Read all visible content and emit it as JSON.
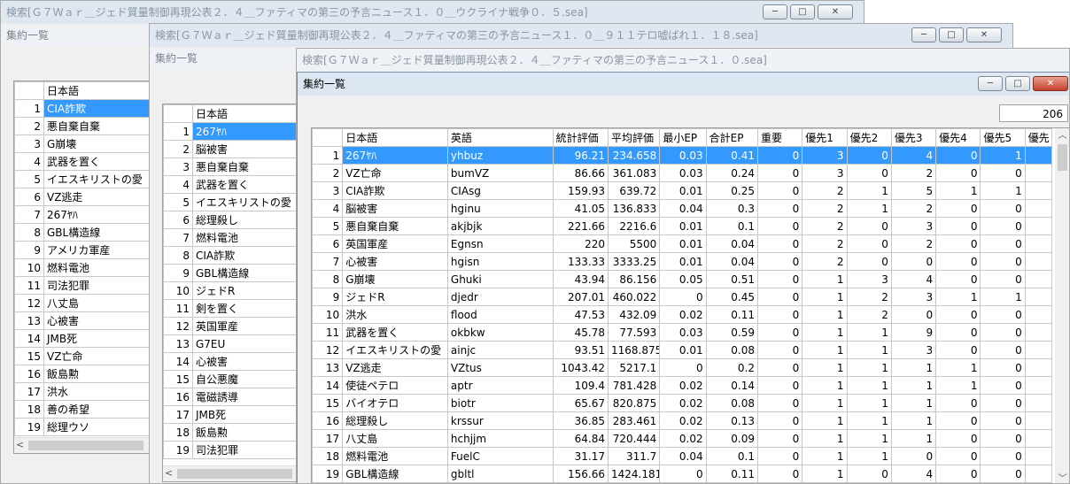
{
  "windows": [
    {
      "title": "検索[Ｇ７Ｗａｒ＿ジェド質量制御再現公表２．４＿ファティマの第三の予言ニュース１．０＿ウクライナ戦争０．５.sea]",
      "sub": "集約一覧",
      "header": "日本語",
      "rownums": [
        "1",
        "2",
        "3",
        "4",
        "5",
        "6",
        "7",
        "8",
        "9",
        "10",
        "11",
        "12",
        "13",
        "14",
        "15",
        "16",
        "17",
        "18",
        "19"
      ],
      "rows": [
        "CIA詐欺",
        "悪自棄自棄",
        "G崩壊",
        "武器を置く",
        "イエスキリストの愛",
        "VZ逃走",
        "267ﾔﾊ",
        "GBL構造線",
        "アメリカ軍産",
        "燃料電池",
        "司法犯罪",
        "八丈島",
        "心被害",
        "JMB死",
        "VZ亡命",
        "飯島勲",
        "洪水",
        "善の希望",
        "総理ウソ"
      ]
    },
    {
      "title": "検索[Ｇ７Ｗａｒ＿ジェド質量制御再現公表２．４＿ファティマの第三の予言ニュース１．０＿９１１テロ嘘ばれ１．１８.sea]",
      "sub": "集約一覧",
      "header": "日本語",
      "rownums": [
        "1",
        "2",
        "3",
        "4",
        "5",
        "6",
        "7",
        "8",
        "9",
        "10",
        "11",
        "12",
        "13",
        "14",
        "15",
        "16",
        "17",
        "18",
        "19"
      ],
      "rows": [
        "267ﾔﾊ",
        "脳被害",
        "悪自棄自棄",
        "武器を置く",
        "イエスキリストの愛",
        "総理殺し",
        "燃料電池",
        "CIA詐欺",
        "GBL構造線",
        "ジェドR",
        "剣を置く",
        "英国軍産",
        "G7EU",
        "心被害",
        "自公悪魔",
        "電磁誘導",
        "JMB死",
        "飯島勲",
        "司法犯罪"
      ]
    },
    {
      "title": "検索[Ｇ７Ｗａｒ＿ジェド質量制御再現公表２．４＿ファティマの第三の予言ニュース１．０.sea]",
      "sub": "集約一覧"
    }
  ],
  "active": {
    "title": "集約一覧",
    "count": "206",
    "columns": [
      "日本語",
      "英語",
      "統計評価",
      "平均評価",
      "最小EP",
      "合計EP",
      "重要",
      "優先1",
      "優先2",
      "優先3",
      "優先4",
      "優先5",
      "優先"
    ],
    "rows": [
      [
        "1",
        "267ﾔﾊ",
        "yhbuz",
        "96.21",
        "234.658",
        "0.03",
        "0.41",
        "0",
        "3",
        "0",
        "4",
        "0",
        "1"
      ],
      [
        "2",
        "VZ亡命",
        "bumVZ",
        "86.66",
        "361.083",
        "0.03",
        "0.24",
        "0",
        "3",
        "0",
        "2",
        "0",
        "0"
      ],
      [
        "3",
        "CIA詐欺",
        "CIAsg",
        "159.93",
        "639.72",
        "0.01",
        "0.25",
        "0",
        "2",
        "1",
        "5",
        "1",
        "1"
      ],
      [
        "4",
        "脳被害",
        "hginu",
        "41.05",
        "136.833",
        "0.04",
        "0.3",
        "0",
        "2",
        "1",
        "2",
        "0",
        "0"
      ],
      [
        "5",
        "悪自棄自棄",
        "akjbjk",
        "221.66",
        "2216.6",
        "0.01",
        "0.1",
        "0",
        "2",
        "0",
        "3",
        "0",
        "0"
      ],
      [
        "6",
        "英国軍産",
        "Egnsn",
        "220",
        "5500",
        "0.01",
        "0.04",
        "0",
        "2",
        "0",
        "2",
        "0",
        "0"
      ],
      [
        "7",
        "心被害",
        "hgisn",
        "133.33",
        "3333.25",
        "0.01",
        "0.04",
        "0",
        "2",
        "0",
        "0",
        "0",
        "0"
      ],
      [
        "8",
        "G崩壊",
        "Ghuki",
        "43.94",
        "86.156",
        "0.05",
        "0.51",
        "0",
        "1",
        "3",
        "4",
        "0",
        "0"
      ],
      [
        "9",
        "ジェドR",
        "djedr",
        "207.01",
        "460.022",
        "0",
        "0.45",
        "0",
        "1",
        "2",
        "3",
        "1",
        "1"
      ],
      [
        "10",
        "洪水",
        "flood",
        "47.53",
        "432.09",
        "0.02",
        "0.11",
        "0",
        "1",
        "2",
        "0",
        "0",
        "0"
      ],
      [
        "11",
        "武器を置く",
        "okbkw",
        "45.78",
        "77.593",
        "0.03",
        "0.59",
        "0",
        "1",
        "1",
        "9",
        "0",
        "0"
      ],
      [
        "12",
        "イエスキリストの愛",
        "ainjc",
        "93.51",
        "1168.875",
        "0.01",
        "0.08",
        "0",
        "1",
        "1",
        "3",
        "0",
        "0"
      ],
      [
        "13",
        "VZ逃走",
        "VZtus",
        "1043.42",
        "5217.1",
        "0",
        "0.2",
        "0",
        "1",
        "1",
        "1",
        "1",
        "0"
      ],
      [
        "14",
        "使徒ペテロ",
        "aptr",
        "109.4",
        "781.428",
        "0.02",
        "0.14",
        "0",
        "1",
        "1",
        "1",
        "1",
        "0"
      ],
      [
        "15",
        "バイオテロ",
        "biotr",
        "65.67",
        "820.875",
        "0.02",
        "0.08",
        "0",
        "1",
        "1",
        "1",
        "0",
        "0"
      ],
      [
        "16",
        "総理殺し",
        "krssur",
        "36.85",
        "283.461",
        "0.02",
        "0.13",
        "0",
        "1",
        "1",
        "1",
        "0",
        "0"
      ],
      [
        "17",
        "八丈島",
        "hchjjm",
        "64.84",
        "720.444",
        "0.02",
        "0.09",
        "0",
        "1",
        "1",
        "1",
        "0",
        "0"
      ],
      [
        "18",
        "燃料電池",
        "FuelC",
        "31.17",
        "311.7",
        "0.04",
        "0.1",
        "0",
        "1",
        "1",
        "0",
        "0",
        "0"
      ],
      [
        "19",
        "GBL構造線",
        "gbltl",
        "156.66",
        "1424.181",
        "0",
        "0.11",
        "0",
        "1",
        "0",
        "4",
        "0",
        "0"
      ]
    ]
  },
  "icons": {
    "minimize": "─",
    "maximize": "□",
    "close": "✕",
    "left": "<",
    "up": "︿",
    "down": "﹀"
  }
}
